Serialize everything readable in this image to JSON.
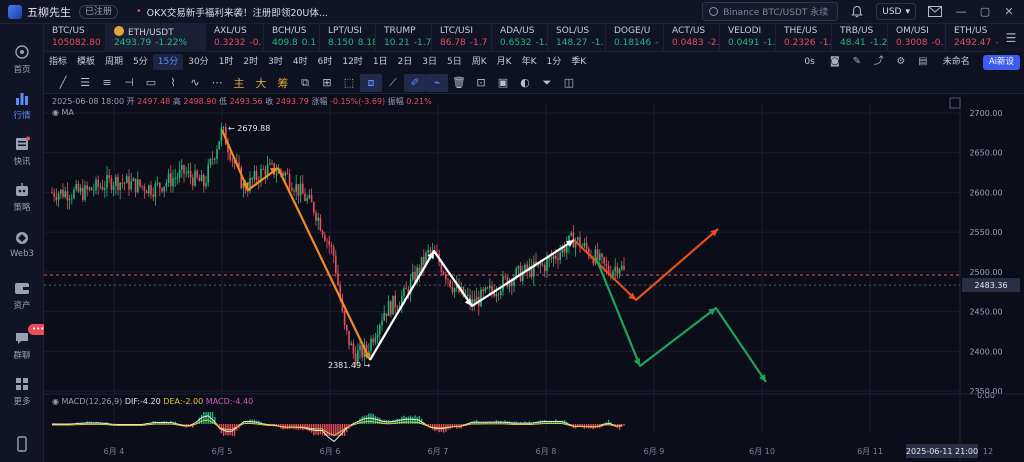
{
  "titlebar": {
    "app_name": "五柳先生",
    "auth_badge": "已注册",
    "announcement": "OKX交易新手福利来袭！注册即领20U体...",
    "search_placeholder": "Binance BTC/USDT 永续",
    "currency": "USD"
  },
  "sidebar": {
    "items": [
      {
        "label": "首页",
        "icon": "home-icon"
      },
      {
        "label": "行情",
        "icon": "market-chart-icon"
      },
      {
        "label": "快讯",
        "icon": "news-icon"
      },
      {
        "label": "策略",
        "icon": "robot-icon"
      },
      {
        "label": "Web3",
        "icon": "web3-icon"
      },
      {
        "label": "资产",
        "icon": "wallet-icon"
      },
      {
        "label": "群聊",
        "icon": "chat-icon"
      },
      {
        "label": "更多",
        "icon": "grid-more-icon"
      }
    ],
    "chat_badge": "•••"
  },
  "tickers": [
    {
      "symbol": "BTC/US",
      "price": "105082.80",
      "change": "",
      "dir": "dn"
    },
    {
      "symbol": "ETH/USDT",
      "price": "2493.79",
      "change": "-1.22%",
      "dir": "up"
    },
    {
      "symbol": "AXL/US",
      "price": "0.3232",
      "change": "-0.",
      "dir": "dn"
    },
    {
      "symbol": "BCH/US",
      "price": "409.8",
      "change": "0.1",
      "dir": "up"
    },
    {
      "symbol": "LPT/USI",
      "price": "8.150",
      "change": "8.18",
      "dir": "up"
    },
    {
      "symbol": "TRUMP",
      "price": "10.21",
      "change": "-1.7",
      "dir": "up"
    },
    {
      "symbol": "LTC/USI",
      "price": "86.78",
      "change": "-1.7",
      "dir": "dn"
    },
    {
      "symbol": "ADA/US",
      "price": "0.6532",
      "change": "-1.",
      "dir": "up"
    },
    {
      "symbol": "SOL/US",
      "price": "148.27",
      "change": "-1.",
      "dir": "up"
    },
    {
      "symbol": "DOGE/U",
      "price": "0.18146",
      "change": "-",
      "dir": "up"
    },
    {
      "symbol": "ACT/US",
      "price": "0.0483",
      "change": "-2.",
      "dir": "dn"
    },
    {
      "symbol": "VELODI",
      "price": "0.0491",
      "change": "-1.",
      "dir": "up"
    },
    {
      "symbol": "THE/US",
      "price": "0.2326",
      "change": "-1.",
      "dir": "dn"
    },
    {
      "symbol": "TRB/US",
      "price": "48.41",
      "change": "-1.2",
      "dir": "up"
    },
    {
      "symbol": "OM/USI",
      "price": "0.3008",
      "change": "-0.",
      "dir": "dn"
    },
    {
      "symbol": "ETH/US",
      "price": "2492.47",
      "change": "-",
      "dir": "dn"
    }
  ],
  "periodbar": {
    "items": [
      "指标",
      "模板",
      "周期",
      "5分",
      "15分",
      "30分",
      "1时",
      "2时",
      "3时",
      "4时",
      "6时",
      "12时",
      "1日",
      "2日",
      "3日",
      "5日",
      "周K",
      "月K",
      "年K",
      "1分",
      "季K"
    ],
    "active": "15分",
    "right_time": "0s",
    "layout_name": "未命名",
    "ai_label": "Ai新设"
  },
  "drawbar": {
    "cn_tools": [
      "主",
      "大",
      "筹"
    ]
  },
  "chart": {
    "info": {
      "date": "2025-06-08 18:00",
      "open_label": "开",
      "open": "2497.48",
      "high_label": "高",
      "high": "2498.90",
      "low_label": "低",
      "low": "2493.56",
      "close_label": "收",
      "close": "2493.79",
      "chg_label": "涨幅",
      "chg": "-0.15%(-3.69)",
      "amp_label": "振幅",
      "amp": "0.21%"
    },
    "ma_label": "MA",
    "high_marker": "2679.88",
    "low_marker": "2381.49",
    "current_price": "2483.36",
    "macd": {
      "name": "MACD(12,26,9)",
      "dif": "DIF:-4.20",
      "dea": "DEA:-2.00",
      "macd": "MACD:-4.40"
    },
    "x_labels": [
      "6月 4",
      "6月 5",
      "6月 6",
      "6月 7",
      "6月 8",
      "6月 9",
      "6月 10",
      "6月 11"
    ],
    "crosshair_time": "2025-06-11 21:00",
    "x_extra": "12",
    "y_ticks": [
      "2700.00",
      "2650.00",
      "2600.00",
      "2550.00",
      "2500.00",
      "2450.00",
      "2400.00",
      "2350.00",
      "0.00"
    ]
  },
  "colors": {
    "up": "#25b87a",
    "down": "#e94e5b",
    "accent": "#5b8cff",
    "orange_path": "#f08a24",
    "white_path": "#ffffff",
    "projection_up": "#e2501d",
    "projection_down": "#1fa35a"
  }
}
